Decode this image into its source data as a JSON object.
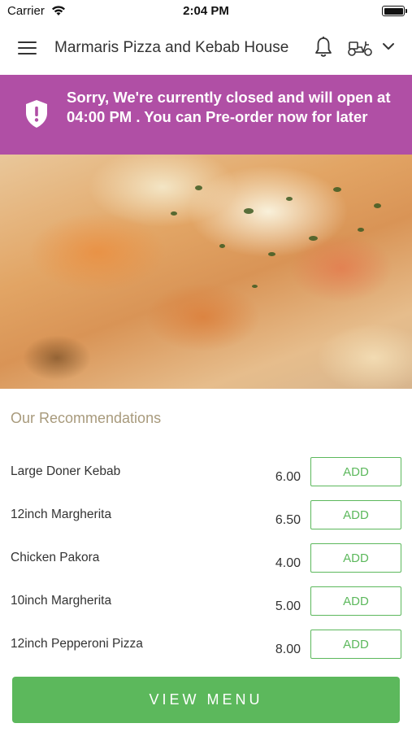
{
  "status_bar": {
    "carrier": "Carrier",
    "time": "2:04 PM"
  },
  "header": {
    "title": "Marmaris Pizza and Kebab House",
    "menu_icon": "hamburger-menu-icon",
    "notification_icon": "bell-icon",
    "delivery_icon": "scooter-icon",
    "dropdown_icon": "chevron-down-icon"
  },
  "banner": {
    "text": "Sorry, We're currently closed and will open at 04:00 PM . You can Pre-order now for later",
    "icon": "shield-alert-icon",
    "color": "#b04fa5"
  },
  "recommendations": {
    "title": "Our Recommendations",
    "items": [
      {
        "name": "Large Doner Kebab",
        "price": "6.00",
        "button": "ADD"
      },
      {
        "name": "12inch Margherita",
        "price": "6.50",
        "button": "ADD"
      },
      {
        "name": "Chicken Pakora",
        "price": "4.00",
        "button": "ADD"
      },
      {
        "name": "10inch Margherita",
        "price": "5.00",
        "button": "ADD"
      },
      {
        "name": "12inch Pepperoni Pizza",
        "price": "8.00",
        "button": "ADD"
      }
    ]
  },
  "view_menu": {
    "label": "VIEW MENU",
    "color": "#5cb85c"
  },
  "colors": {
    "accent_green": "#5cb85c",
    "section_title": "#a89a7c"
  }
}
